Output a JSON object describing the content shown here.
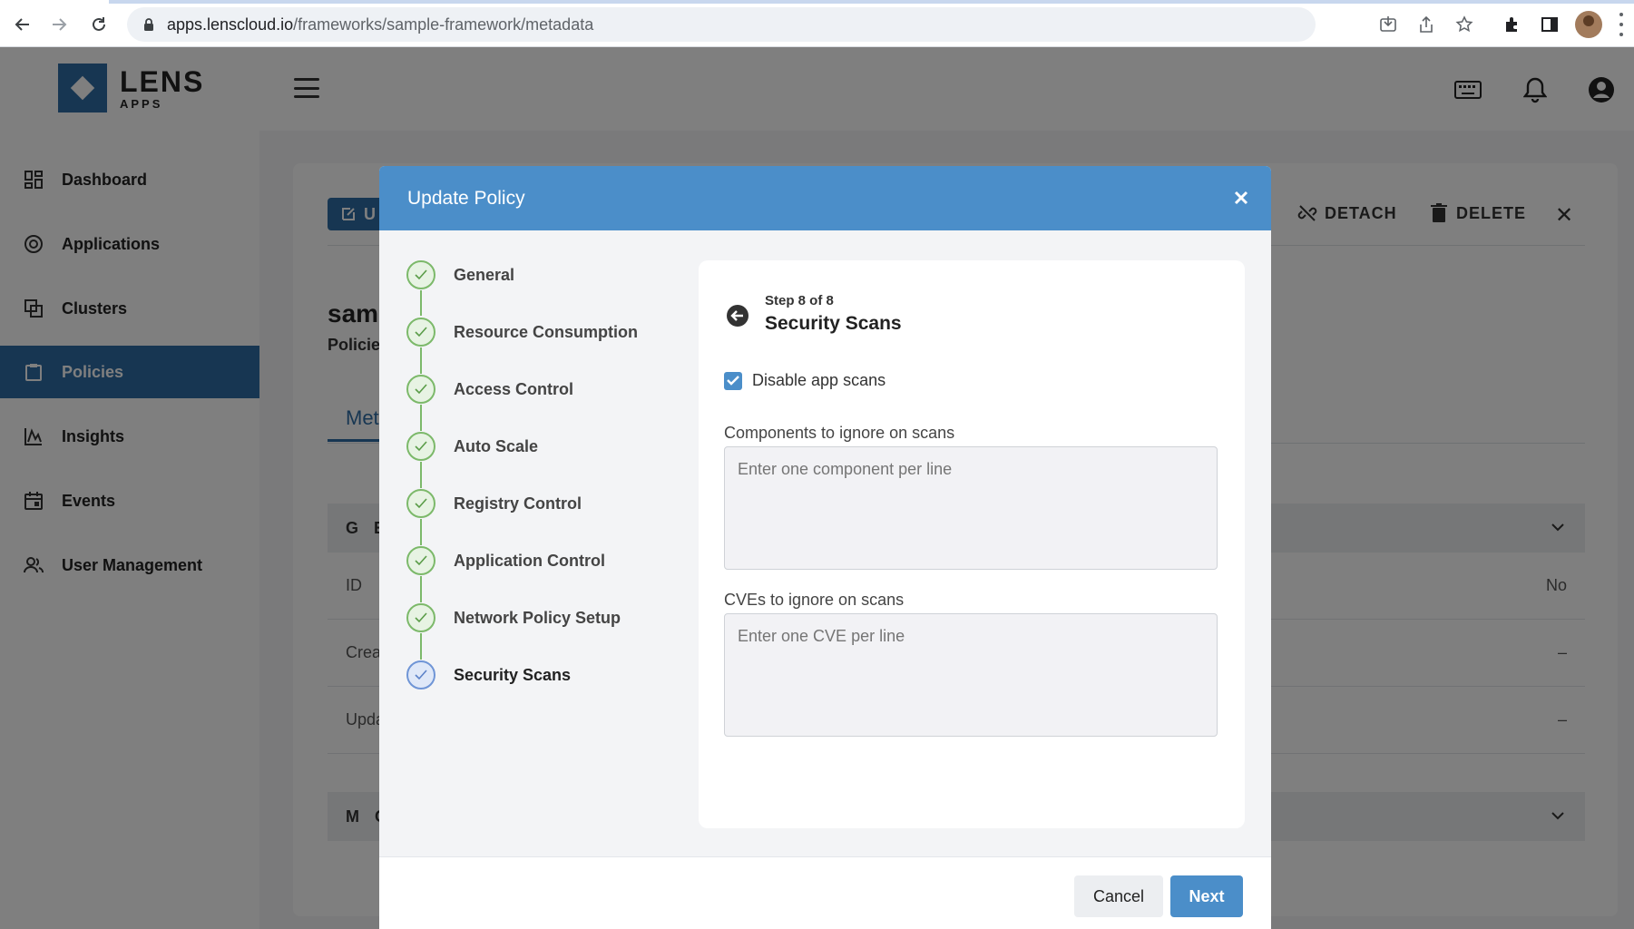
{
  "browser": {
    "url_host": "apps.lenscloud.io",
    "url_path": "/frameworks/sample-framework/metadata"
  },
  "app": {
    "logo_text": "LENS",
    "logo_sub": "APPS"
  },
  "sidebar": {
    "items": [
      {
        "label": "Dashboard",
        "icon": "dashboard-icon"
      },
      {
        "label": "Applications",
        "icon": "applications-icon"
      },
      {
        "label": "Clusters",
        "icon": "clusters-icon"
      },
      {
        "label": "Policies",
        "icon": "policies-icon",
        "active": true
      },
      {
        "label": "Insights",
        "icon": "insights-icon"
      },
      {
        "label": "Events",
        "icon": "events-icon"
      },
      {
        "label": "User Management",
        "icon": "users-icon"
      }
    ]
  },
  "background_card": {
    "update_label": "U",
    "detach_label": "DETACH",
    "delete_label": "DELETE",
    "title_partial": "sam",
    "subtitle_partial": "Policie",
    "tab_partial": "Met",
    "section_general": "G E",
    "section_more": "M O",
    "rows": [
      {
        "label": "ID",
        "value": "No"
      },
      {
        "label": "Crea",
        "value": "–"
      },
      {
        "label": "Upda",
        "value": "–"
      }
    ]
  },
  "modal": {
    "title": "Update Policy",
    "steps": [
      {
        "label": "General",
        "state": "done"
      },
      {
        "label": "Resource Consumption",
        "state": "done"
      },
      {
        "label": "Access Control",
        "state": "done"
      },
      {
        "label": "Auto Scale",
        "state": "done"
      },
      {
        "label": "Registry Control",
        "state": "done"
      },
      {
        "label": "Application Control",
        "state": "done"
      },
      {
        "label": "Network Policy Setup",
        "state": "done"
      },
      {
        "label": "Security Scans",
        "state": "current"
      }
    ],
    "step_counter": "Step 8 of 8",
    "step_title": "Security Scans",
    "disable_scans_label": "Disable app scans",
    "disable_scans_checked": true,
    "components_label": "Components to ignore on scans",
    "components_placeholder": "Enter one component per line",
    "cves_label": "CVEs to ignore on scans",
    "cves_placeholder": "Enter one CVE per line",
    "cancel_label": "Cancel",
    "next_label": "Next"
  },
  "colors": {
    "brand": "#2e6da4",
    "modal_header": "#4b8ec9",
    "step_done": "#7cb96a"
  }
}
